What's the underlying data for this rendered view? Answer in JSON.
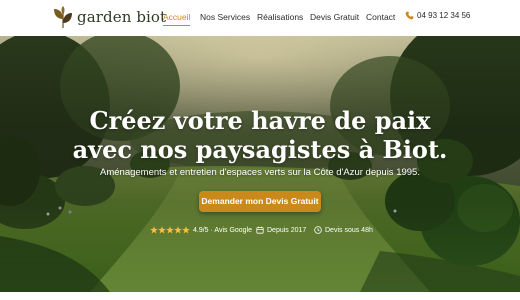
{
  "brand": {
    "name": "garden biot",
    "logo_icon": "leaf-logo-icon",
    "colors": {
      "accent": "#c98a1b",
      "dark_green": "#2f3a24"
    }
  },
  "nav": {
    "items": [
      {
        "label": "Accueil",
        "active": true
      },
      {
        "label": "Nos Services",
        "active": false
      },
      {
        "label": "Réalisations",
        "active": false
      },
      {
        "label": "Devis Gratuit",
        "active": false
      },
      {
        "label": "Contact",
        "active": false
      }
    ],
    "phone": {
      "icon": "phone-icon",
      "number": "04 93 12 34 56"
    }
  },
  "hero": {
    "title_line1": "Créez votre havre de paix",
    "title_line2": "avec nos paysagistes à Biot.",
    "subtitle": "Aménagements et entretien d'espaces verts sur la Côte d'Azur depuis 1995.",
    "cta_label": "Demander mon Devis Gratuit",
    "badges": {
      "rating": {
        "icon": "star-icon",
        "stars": 5,
        "text": "4.9/5 · Avis Google"
      },
      "since": {
        "icon": "calendar-icon",
        "text": "Depuis 2017"
      },
      "quote": {
        "icon": "clock-icon",
        "text": "Devis sous 48h"
      }
    }
  }
}
